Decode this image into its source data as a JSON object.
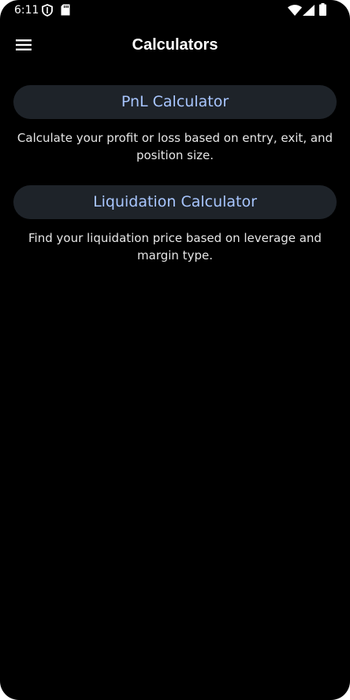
{
  "status_bar": {
    "time": "6:11",
    "icons": [
      "shield-icon",
      "sd-card-icon",
      "wifi-icon",
      "signal-icon",
      "battery-icon"
    ]
  },
  "app_bar": {
    "title": "Calculators",
    "menu_icon": "menu-icon"
  },
  "calculators": [
    {
      "label": "PnL Calculator",
      "description": "Calculate your profit or loss based on entry, exit, and position size."
    },
    {
      "label": "Liquidation Calculator",
      "description": "Find your liquidation price based on leverage and margin type."
    }
  ],
  "colors": {
    "background": "#000000",
    "button_background": "#1e2329",
    "button_text": "#a8c6ff",
    "description_text": "#e6e6e6",
    "title_text": "#ffffff"
  }
}
